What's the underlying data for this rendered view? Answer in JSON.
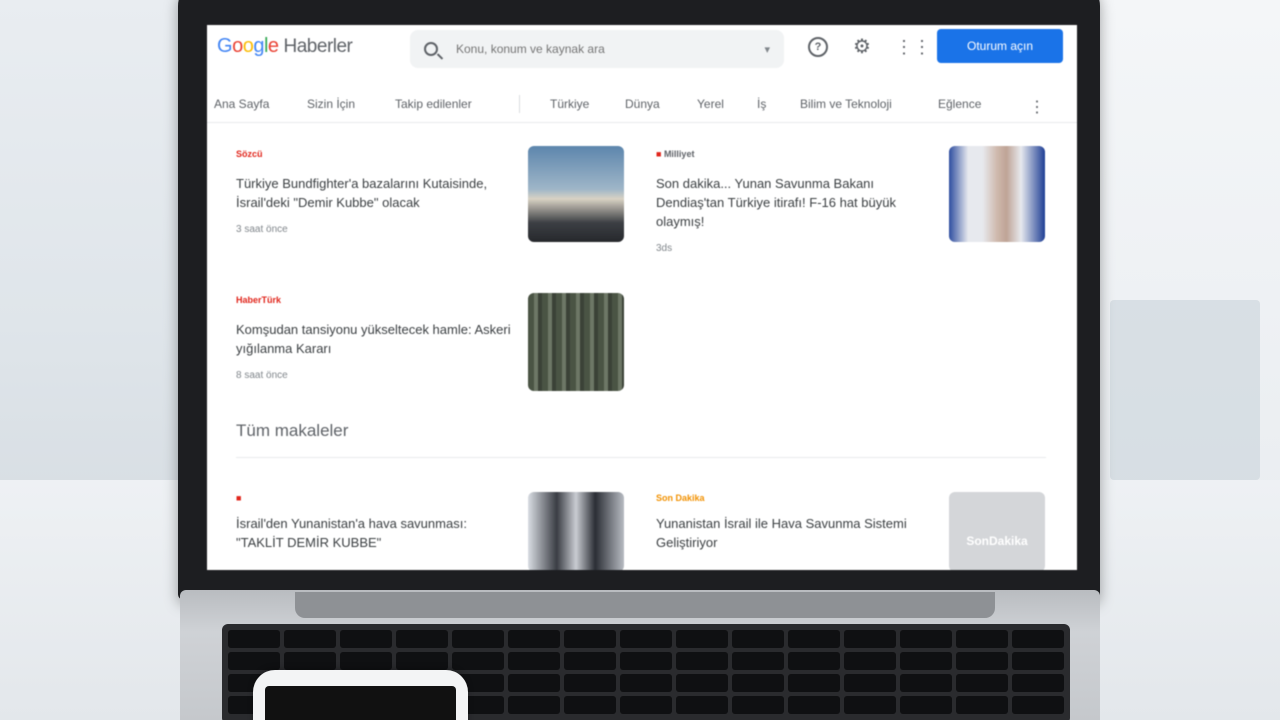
{
  "header": {
    "logo_google": [
      "G",
      "o",
      "o",
      "g",
      "l",
      "e"
    ],
    "logo_product": "Haberler",
    "search_placeholder": "Konu, konum ve kaynak ara",
    "login_label": "Oturum açın"
  },
  "nav": {
    "items": [
      "Ana Sayfa",
      "Sizin İçin",
      "Takip edilenler",
      "Türkiye",
      "Dünya",
      "Yerel",
      "İş",
      "Bilim ve Teknoloji",
      "Eğlence"
    ]
  },
  "cards": [
    {
      "source": "Sözcü",
      "source_color": "#e1251b",
      "title": "Türkiye Bundfighter'a bazalarını Kutaisinde, İsrail'deki \"Demir Kubbe\" olacak",
      "time": "3 saat önce"
    },
    {
      "source": "Milliyet",
      "source_color": "#e1251b",
      "title": "Son dakika... Yunan Savunma Bakanı Dendiaş'tan Türkiye itirafı! F-16 hat büyük olaymış!",
      "time": "3ds"
    },
    {
      "source": "HaberTürk",
      "source_color": "#e1251b",
      "title": "Komşudan tansiyonu yükseltecek hamle: Askeri yığılanma Kararı",
      "time": "8 saat önce"
    }
  ],
  "section_title": "Tüm makaleler",
  "all_articles": [
    {
      "source": "",
      "source_color": "#e1251b",
      "title": "İsrail'den Yunanistan'a hava savunması: \"TAKLİT DEMİR KUBBE\""
    },
    {
      "source": "Son Dakika",
      "source_color": "#f29100",
      "title": "Yunanistan İsrail ile Hava Savunma Sistemi Geliştiriyor",
      "thumb_label": "SonDakika"
    }
  ]
}
